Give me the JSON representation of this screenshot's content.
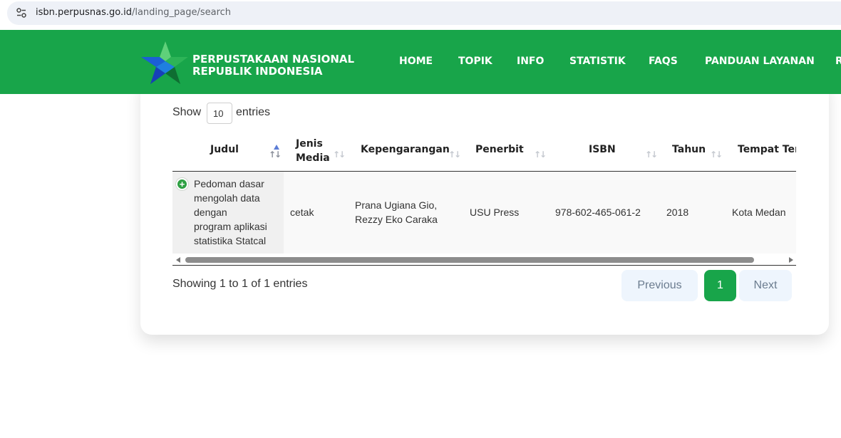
{
  "browser": {
    "url_host": "isbn.perpusnas.go.id",
    "url_path": "/landing_page/search"
  },
  "header": {
    "brand_line1": "PERPUSTAKAAN NASIONAL",
    "brand_line2": "REPUBLIK INDONESIA",
    "nav": [
      "HOME",
      "TOPIK",
      "INFO",
      "STATISTIK",
      "FAQS",
      "PANDUAN LAYANAN",
      "R"
    ],
    "bg_color": "#18a54a"
  },
  "table_controls": {
    "show_label": "Show",
    "entries_value": "10",
    "entries_label": "entries"
  },
  "table": {
    "columns": [
      "Judul",
      "Jenis Media",
      "Kepengarangan",
      "Penerbit",
      "ISBN",
      "Tahun",
      "Tempat Terl"
    ],
    "jenis_line1": "Jenis",
    "jenis_line2": "Media",
    "rows": [
      {
        "judul": [
          "Pedoman dasar",
          "mengolah data",
          "dengan",
          "program aplikasi",
          "statistika Statcal"
        ],
        "jenis_media": "cetak",
        "kepengarangan": [
          "Prana Ugiana Gio,",
          "Rezzy Eko Caraka"
        ],
        "penerbit": "USU Press",
        "isbn": "978-602-465-061-2",
        "tahun": "2018",
        "tempat": "Kota Medan"
      }
    ]
  },
  "footer": {
    "info": "Showing 1 to 1 of 1 entries",
    "prev": "Previous",
    "page": "1",
    "next": "Next"
  }
}
